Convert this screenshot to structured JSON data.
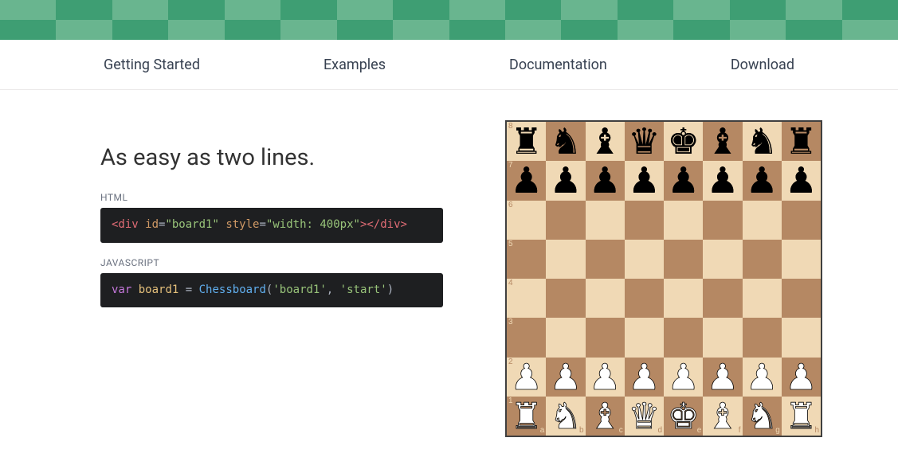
{
  "nav": {
    "items": [
      "Getting Started",
      "Examples",
      "Documentation",
      "Download"
    ]
  },
  "main": {
    "heading": "As easy as two lines.",
    "snippets": [
      {
        "label": "HTML",
        "tokens": [
          [
            "tag",
            "<div"
          ],
          [
            "op",
            " "
          ],
          [
            "attr",
            "id"
          ],
          [
            "op",
            "="
          ],
          [
            "str",
            "\"board1\""
          ],
          [
            "op",
            " "
          ],
          [
            "attr",
            "style"
          ],
          [
            "op",
            "="
          ],
          [
            "str",
            "\"width: 400px\""
          ],
          [
            "tag",
            ">"
          ],
          [
            "tag",
            "</div>"
          ]
        ]
      },
      {
        "label": "JAVASCRIPT",
        "tokens": [
          [
            "kw",
            "var"
          ],
          [
            "op",
            " "
          ],
          [
            "var",
            "board1"
          ],
          [
            "op",
            " "
          ],
          [
            "op",
            "="
          ],
          [
            "op",
            " "
          ],
          [
            "fn",
            "Chessboard"
          ],
          [
            "pun",
            "("
          ],
          [
            "str",
            "'board1'"
          ],
          [
            "pun",
            ","
          ],
          [
            "op",
            " "
          ],
          [
            "str",
            "'start'"
          ],
          [
            "pun",
            ")"
          ]
        ]
      }
    ]
  },
  "board": {
    "ranks": [
      "8",
      "7",
      "6",
      "5",
      "4",
      "3",
      "2",
      "1"
    ],
    "files": [
      "a",
      "b",
      "c",
      "d",
      "e",
      "f",
      "g",
      "h"
    ],
    "piece_glyph": {
      "br": "♜",
      "bn": "♞",
      "bb": "♝",
      "bq": "♛",
      "bk": "♚",
      "bp": "♟",
      "wr": "♜",
      "wn": "♞",
      "wb": "♝",
      "wq": "♛",
      "wk": "♚",
      "wp": "♟"
    },
    "position": [
      [
        "br",
        "bn",
        "bb",
        "bq",
        "bk",
        "bb",
        "bn",
        "br"
      ],
      [
        "bp",
        "bp",
        "bp",
        "bp",
        "bp",
        "bp",
        "bp",
        "bp"
      ],
      [
        null,
        null,
        null,
        null,
        null,
        null,
        null,
        null
      ],
      [
        null,
        null,
        null,
        null,
        null,
        null,
        null,
        null
      ],
      [
        null,
        null,
        null,
        null,
        null,
        null,
        null,
        null
      ],
      [
        null,
        null,
        null,
        null,
        null,
        null,
        null,
        null
      ],
      [
        "wp",
        "wp",
        "wp",
        "wp",
        "wp",
        "wp",
        "wp",
        "wp"
      ],
      [
        "wr",
        "wn",
        "wb",
        "wq",
        "wk",
        "wb",
        "wn",
        "wr"
      ]
    ]
  }
}
